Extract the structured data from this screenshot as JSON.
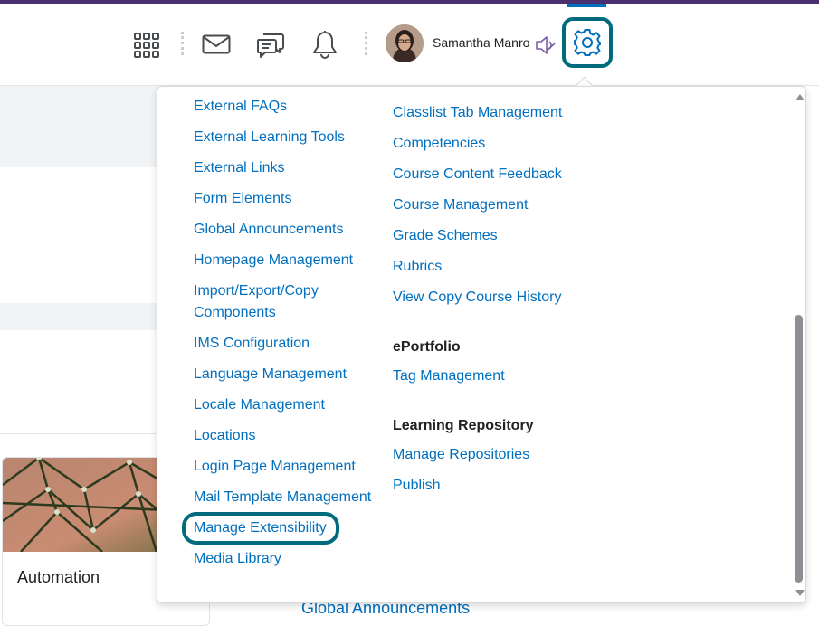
{
  "header": {
    "user_name": "Samantha Manro",
    "icons": [
      "app-launcher-icon",
      "mail-icon",
      "chat-icon",
      "bell-icon",
      "speaker-icon",
      "gear-icon"
    ]
  },
  "background": {
    "card_title": "Automation",
    "bottom_link": "Global Announcements"
  },
  "dropdown": {
    "col1": [
      "External FAQs",
      "External Learning Tools",
      "External Links",
      "Form Elements",
      "Global Announcements",
      "Homepage Management",
      "Import/Export/Copy Components",
      "IMS Configuration",
      "Language Management",
      "Locale Management",
      "Locations",
      "Login Page Management",
      "Mail Template Management",
      "Manage Extensibility",
      "Media Library"
    ],
    "col2": [
      "Classlist Tab Management",
      "Competencies",
      "Course Content Feedback",
      "Course Management",
      "Grade Schemes",
      "Rubrics",
      "View Copy Course History"
    ],
    "eportfolio_heading": "ePortfolio",
    "eportfolio_items": [
      "Tag Management"
    ],
    "learning_repo_heading": "Learning Repository",
    "learning_repo_items": [
      "Manage Repositories",
      "Publish"
    ],
    "highlighted_item": "Manage Extensibility"
  },
  "colors": {
    "accent_teal": "#006b7d",
    "link_blue": "#006fbf",
    "top_strip": "#4a2f6e"
  }
}
